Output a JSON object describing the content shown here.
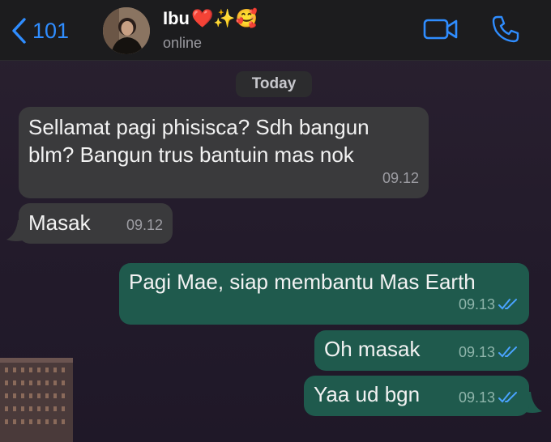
{
  "header": {
    "back_count": "101",
    "contact_name": "Ibu",
    "contact_emojis": "❤️✨🥰",
    "status": "online"
  },
  "chat": {
    "date_label": "Today",
    "messages": [
      {
        "direction": "in",
        "text_line1": "Sellamat pagi phisisca? Sdh bangun",
        "text_line2": "blm? Bangun trus bantuin mas nok",
        "time": "09.12"
      },
      {
        "direction": "in",
        "text": "Masak",
        "time": "09.12"
      },
      {
        "direction": "out",
        "text": "Pagi Mae, siap membantu Mas Earth",
        "time": "09.13",
        "read": true
      },
      {
        "direction": "out",
        "text": "Oh masak",
        "time": "09.13",
        "read": true
      },
      {
        "direction": "out",
        "text": "Yaa ud bgn",
        "time": "09.13",
        "read": true
      }
    ]
  },
  "colors": {
    "accent": "#2f8dff",
    "incoming_bubble": "#3a3a3c",
    "outgoing_bubble": "#1f5a4d",
    "read_ticks": "#4aa3ff"
  }
}
